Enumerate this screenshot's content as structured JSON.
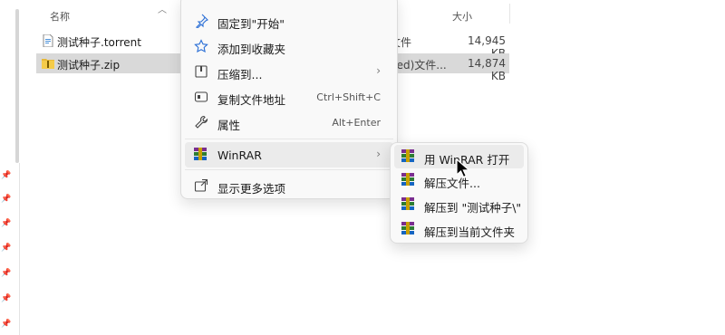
{
  "explorer": {
    "columns": {
      "name": "名称",
      "size": "大小"
    },
    "files": [
      {
        "name": "测试种子.torrent",
        "type": "文件",
        "size": "14,945 KB",
        "icon": "torrent-file-icon",
        "selected": false
      },
      {
        "name": "测试种子.zip",
        "type": "ped)文件...",
        "size": "14,874 KB",
        "icon": "zip-folder-icon",
        "selected": true
      }
    ]
  },
  "context_menu": {
    "items": [
      {
        "label": "固定到\"开始\"",
        "icon": "pin-icon"
      },
      {
        "label": "添加到收藏夹",
        "icon": "star-icon"
      },
      {
        "label": "压缩到...",
        "icon": "archive-icon",
        "submenu": true
      },
      {
        "label": "复制文件地址",
        "icon": "copy-path-icon",
        "shortcut": "Ctrl+Shift+C"
      },
      {
        "label": "属性",
        "icon": "wrench-icon",
        "shortcut": "Alt+Enter"
      },
      {
        "label": "WinRAR",
        "icon": "winrar-icon",
        "submenu": true
      },
      {
        "label": "显示更多选项",
        "icon": "show-more-icon"
      }
    ]
  },
  "winrar_submenu": {
    "items": [
      {
        "label": "用 WinRAR 打开"
      },
      {
        "label": "解压文件..."
      },
      {
        "label": "解压到 \"测试种子\\\""
      },
      {
        "label": "解压到当前文件夹"
      }
    ]
  },
  "colors": {
    "menu_bg": "#f9f9f9",
    "hover_bg": "#ebebeb",
    "selected_row": "#d9d9d9",
    "accent_icon": "#2b6fd6"
  }
}
